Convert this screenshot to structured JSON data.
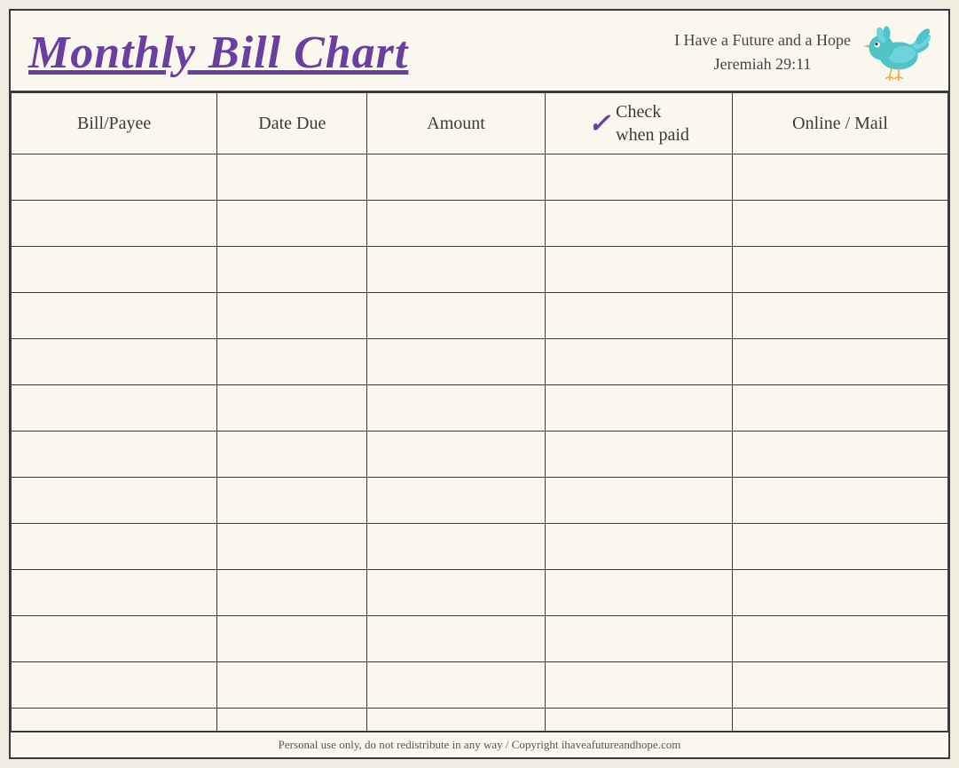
{
  "header": {
    "title": "Monthly Bill Chart",
    "tagline_line1": "I Have a Future and a Hope",
    "tagline_line2": "Jeremiah 29:11"
  },
  "table": {
    "columns": [
      {
        "id": "bill",
        "label": "Bill/Payee"
      },
      {
        "id": "date",
        "label": "Date Due"
      },
      {
        "id": "amount",
        "label": "Amount"
      },
      {
        "id": "check",
        "label_top": "Check",
        "label_bottom": "when paid",
        "checkmark": "✓"
      },
      {
        "id": "online",
        "label": "Online / Mail"
      }
    ],
    "rows": 13
  },
  "footer": {
    "text": "Personal use only, do not redistribute in any way / Copyright ihaveafutureandhope.com"
  }
}
